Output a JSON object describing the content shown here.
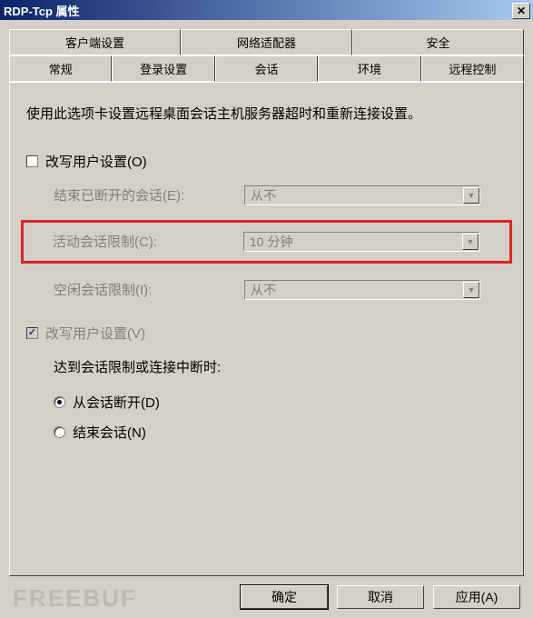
{
  "window": {
    "title": "RDP-Tcp 属性",
    "close_glyph": "✕"
  },
  "tabs_row1": [
    {
      "label": "客户端设置"
    },
    {
      "label": "网络适配器"
    },
    {
      "label": "安全"
    }
  ],
  "tabs_row2": [
    {
      "label": "常规"
    },
    {
      "label": "登录设置"
    },
    {
      "label": "会话",
      "active": true
    },
    {
      "label": "环境"
    },
    {
      "label": "远程控制"
    }
  ],
  "description": "使用此选项卡设置远程桌面会话主机服务器超时和重新连接设置。",
  "override1": {
    "label": "改写用户设置(O)",
    "checked": false
  },
  "fields": {
    "end_disconnected": {
      "label": "结束已断开的会话(E):",
      "value": "从不"
    },
    "active_limit": {
      "label": "活动会话限制(C):",
      "value": "10 分钟"
    },
    "idle_limit": {
      "label": "空闲会话限制(I):",
      "value": "从不"
    }
  },
  "override2": {
    "label": "改写用户设置(V)",
    "checked": true
  },
  "action_heading": "达到会话限制或连接中断时:",
  "radios": {
    "disconnect": {
      "label": "从会话断开(D)",
      "checked": true
    },
    "end": {
      "label": "结束会话(N)",
      "checked": false
    }
  },
  "buttons": {
    "ok": "确定",
    "cancel": "取消",
    "apply": "应用(A)"
  },
  "watermark": "FREEBUF",
  "arrow_glyph": "▼"
}
